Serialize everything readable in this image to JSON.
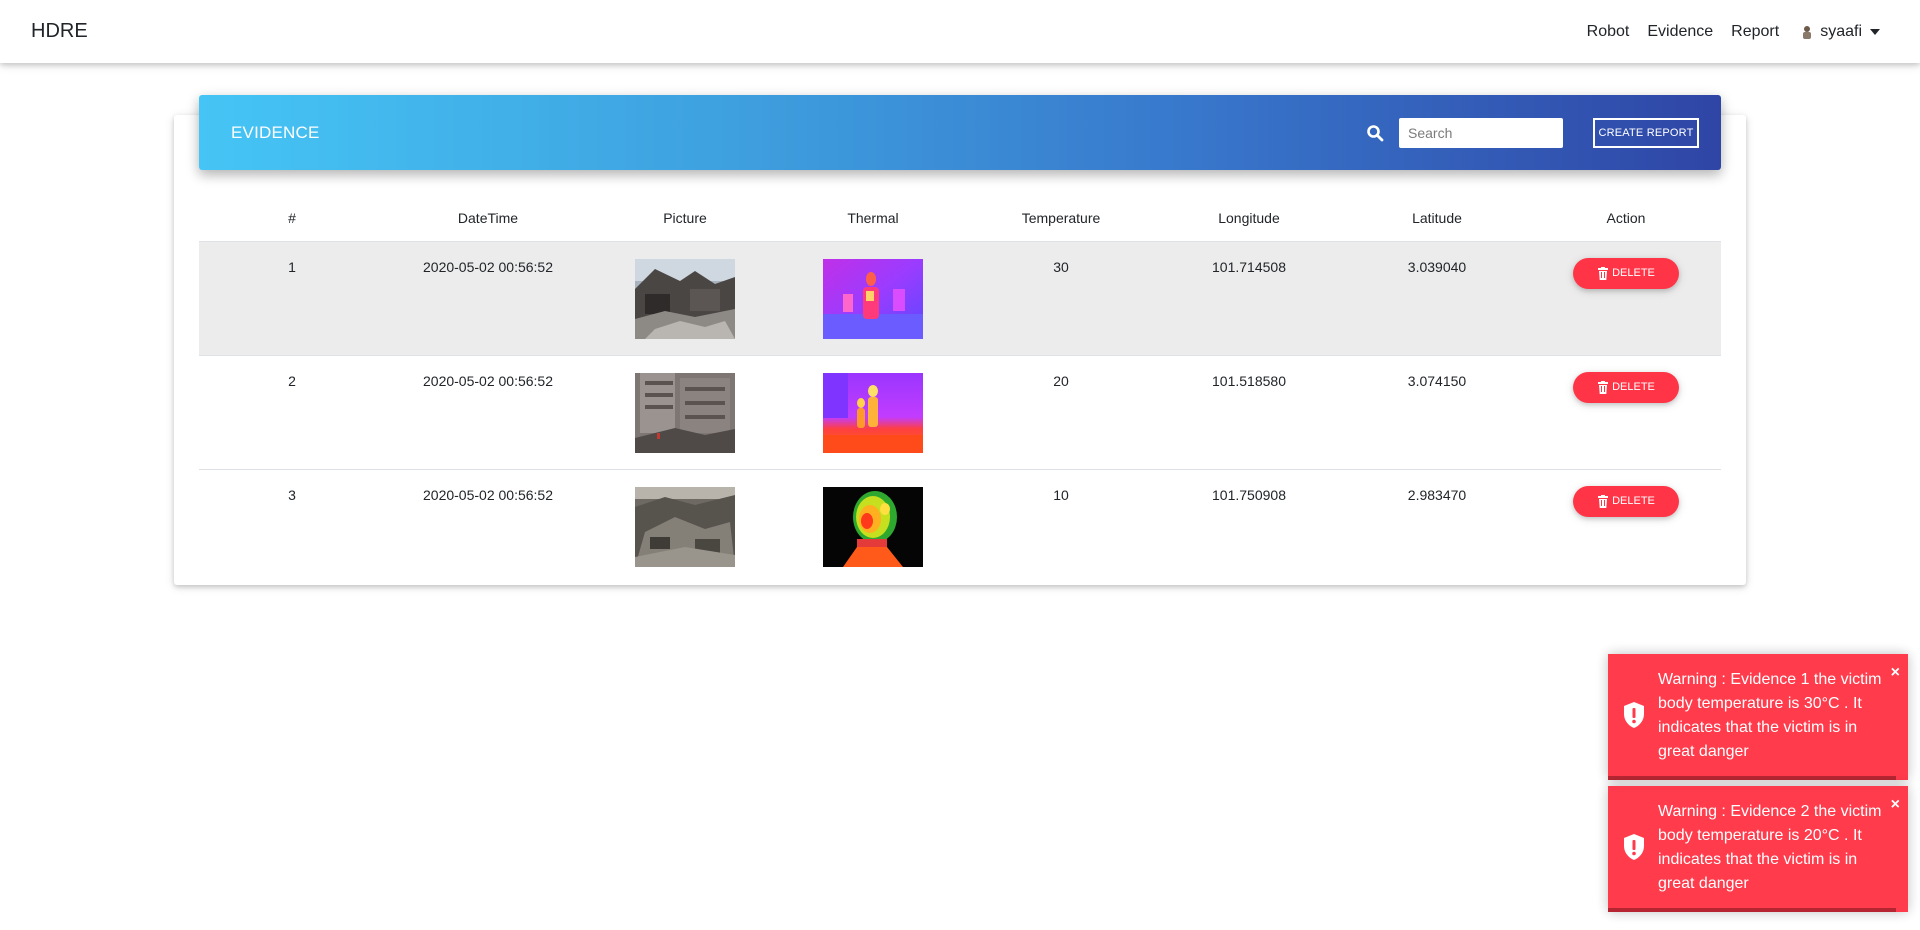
{
  "navbar": {
    "brand": "HDRE",
    "links": [
      "Robot",
      "Evidence",
      "Report"
    ],
    "user": "syaafi"
  },
  "card": {
    "title": "EVIDENCE",
    "search_placeholder": "Search",
    "create_button": "CREATE REPORT"
  },
  "table": {
    "headers": [
      "#",
      "DateTime",
      "Picture",
      "Thermal",
      "Temperature",
      "Longitude",
      "Latitude",
      "Action"
    ],
    "rows": [
      {
        "num": "1",
        "datetime": "2020-05-02 00:56:52",
        "temperature": "30",
        "longitude": "101.714508",
        "latitude": "3.039040",
        "action": "DELETE"
      },
      {
        "num": "2",
        "datetime": "2020-05-02 00:56:52",
        "temperature": "20",
        "longitude": "101.518580",
        "latitude": "3.074150",
        "action": "DELETE"
      },
      {
        "num": "3",
        "datetime": "2020-05-02 00:56:52",
        "temperature": "10",
        "longitude": "101.750908",
        "latitude": "2.983470",
        "action": "DELETE"
      }
    ]
  },
  "toasts": [
    {
      "message": "Warning : Evidence 1 the victim body temperature is 30°C . It indicates that the victim is in great danger",
      "close": "×"
    },
    {
      "message": "Warning : Evidence 2 the victim body temperature is 20°C . It indicates that the victim is in great danger",
      "close": "×"
    }
  ],
  "colors": {
    "danger": "#ff3547",
    "header_gradient_start": "#45c5f5",
    "header_gradient_end": "#2f45a6"
  }
}
